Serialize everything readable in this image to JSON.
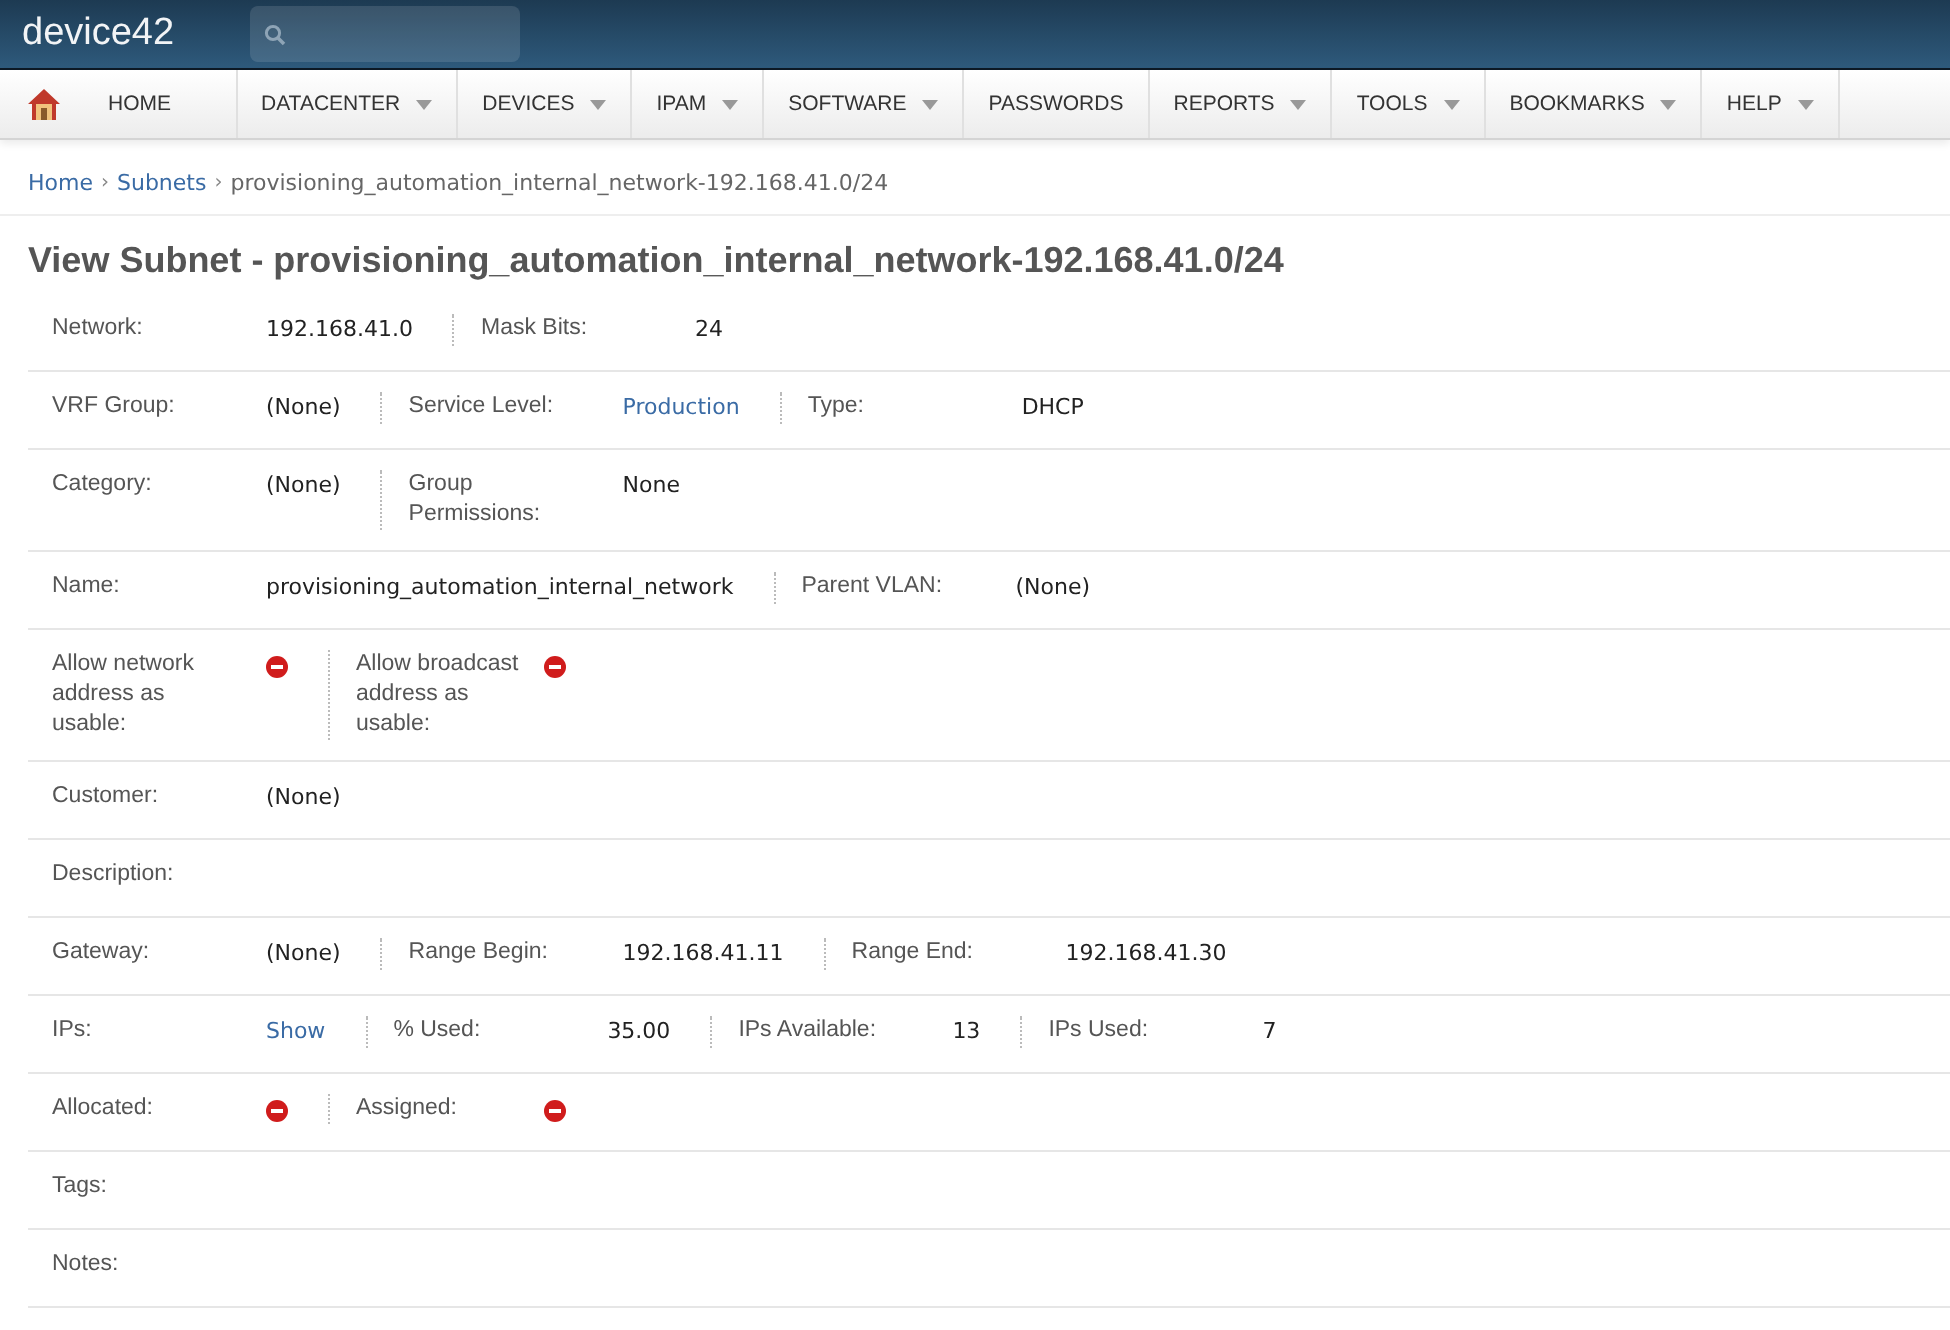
{
  "app": {
    "logo": "device42"
  },
  "nav": [
    {
      "label": "HOME",
      "dropdown": false
    },
    {
      "label": "DATACENTER",
      "dropdown": true
    },
    {
      "label": "DEVICES",
      "dropdown": true
    },
    {
      "label": "IPAM",
      "dropdown": true
    },
    {
      "label": "SOFTWARE",
      "dropdown": true
    },
    {
      "label": "PASSWORDS",
      "dropdown": false
    },
    {
      "label": "REPORTS",
      "dropdown": true
    },
    {
      "label": "TOOLS",
      "dropdown": true
    },
    {
      "label": "BOOKMARKS",
      "dropdown": true
    },
    {
      "label": "HELP",
      "dropdown": true
    }
  ],
  "breadcrumb": [
    {
      "label": "Home",
      "kind": "link"
    },
    {
      "label": "›",
      "kind": "separator"
    },
    {
      "label": "Subnets",
      "kind": "link"
    },
    {
      "label": "›",
      "kind": "separator"
    },
    {
      "label": "provisioning_automation_internal_network-192.168.41.0/24",
      "kind": "current"
    }
  ],
  "title": "View Subnet - provisioning_automation_internal_network-192.168.41.0/24",
  "rows": [
    {
      "fields": [
        {
          "label": "Network:",
          "kind": "text",
          "value": "192.168.41.0"
        },
        {
          "label": "Mask Bits:",
          "kind": "text",
          "value": "24"
        }
      ]
    },
    {
      "fields": [
        {
          "label": "VRF Group:",
          "kind": "text",
          "value": "(None)"
        },
        {
          "label": "Service Level:",
          "kind": "link",
          "value": "Production"
        },
        {
          "label": "Type:",
          "kind": "text",
          "value": "DHCP"
        }
      ]
    },
    {
      "fields": [
        {
          "label": "Category:",
          "kind": "text",
          "value": "(None)"
        },
        {
          "label": "Group Permissions:",
          "kind": "text",
          "value": "None"
        }
      ]
    },
    {
      "fields": [
        {
          "label": "Name:",
          "kind": "text",
          "value": "provisioning_automation_internal_network"
        },
        {
          "label": "Parent VLAN:",
          "kind": "text",
          "value": "(None)"
        }
      ]
    },
    {
      "fields": [
        {
          "label": "Allow network address as usable:",
          "kind": "flag",
          "on": false
        },
        {
          "label": "Allow broadcast address as usable:",
          "kind": "flag",
          "on": false
        }
      ]
    },
    {
      "fields": [
        {
          "label": "Customer:",
          "kind": "text",
          "value": "(None)"
        }
      ]
    },
    {
      "fields": [
        {
          "label": "Description:",
          "kind": "empty"
        }
      ]
    },
    {
      "fields": [
        {
          "label": "Gateway:",
          "kind": "text",
          "value": "(None)"
        },
        {
          "label": "Range Begin:",
          "kind": "text",
          "value": "192.168.41.11"
        },
        {
          "label": "Range End:",
          "kind": "text",
          "value": "192.168.41.30"
        }
      ]
    },
    {
      "fields": [
        {
          "label": "IPs:",
          "kind": "link",
          "value": "Show"
        },
        {
          "label": "% Used:",
          "kind": "text",
          "value": "35.00"
        },
        {
          "label": "IPs Available:",
          "kind": "text",
          "value": "13"
        },
        {
          "label": "IPs Used:",
          "kind": "text",
          "value": "7"
        }
      ]
    },
    {
      "fields": [
        {
          "label": "Allocated:",
          "kind": "flag",
          "on": false
        },
        {
          "label": "Assigned:",
          "kind": "flag",
          "on": false
        }
      ]
    },
    {
      "fields": [
        {
          "label": "Tags:",
          "kind": "empty"
        }
      ]
    },
    {
      "fields": [
        {
          "label": "Notes:",
          "kind": "empty"
        }
      ]
    }
  ]
}
